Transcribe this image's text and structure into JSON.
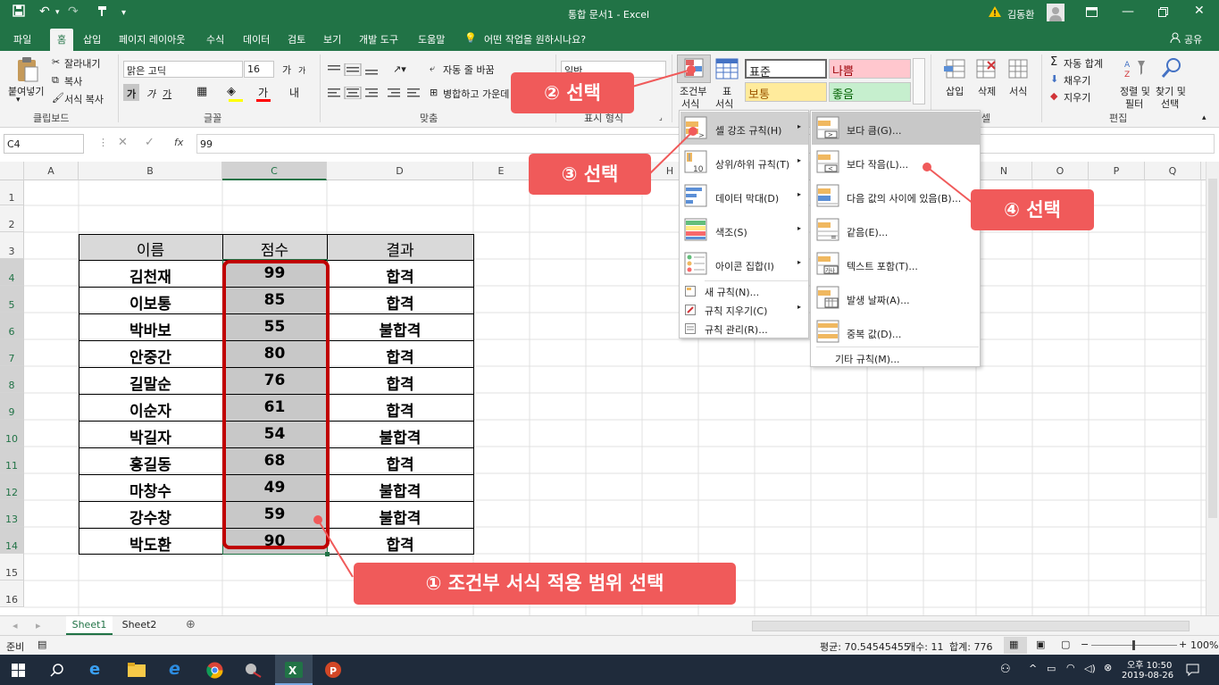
{
  "window": {
    "title": "통합 문서1  -  Excel",
    "user": "김동환",
    "share": "공유"
  },
  "tabs": [
    "파일",
    "홈",
    "삽입",
    "페이지 레이아웃",
    "수식",
    "데이터",
    "검토",
    "보기",
    "개발 도구",
    "도움말"
  ],
  "tell_me": "어떤 작업을 원하시나요?",
  "ribbon": {
    "clipboard": {
      "paste": "붙여넣기",
      "cut": "잘라내기",
      "copy": "복사",
      "format_painter": "서식 복사",
      "label": "클립보드"
    },
    "font": {
      "name": "맑은 고딕",
      "size": "16",
      "grow": "가",
      "shrink": "가",
      "bold": "가",
      "italic": "가",
      "underline": "가",
      "label": "글꼴"
    },
    "align": {
      "wrap": "자동 줄 바꿈",
      "merge": "병합하고 가운데",
      "label": "맞춤"
    },
    "number": {
      "format": "일반",
      "label": "표시 형식"
    },
    "styles": {
      "cond_format_1": "조건부",
      "cond_format_2": "서식",
      "table_1": "표",
      "table_2": "서식",
      "normal": "표준",
      "bad": "나쁨",
      "neutral": "보통",
      "good": "좋음"
    },
    "cells": {
      "insert": "삽입",
      "delete": "삭제",
      "format": "서식",
      "label": "셀"
    },
    "editing": {
      "autosum": "자동 합계",
      "fill": "채우기",
      "clear": "지우기",
      "sort_1": "정렬 및",
      "sort_2": "필터",
      "find_1": "찾기 및",
      "find_2": "선택",
      "label": "편집"
    }
  },
  "formula_bar": {
    "name_box": "C4",
    "fx": "fx",
    "value": "99"
  },
  "columns": [
    "A",
    "B",
    "C",
    "D",
    "E",
    "F",
    "G",
    "H",
    "I",
    "J",
    "K",
    "L",
    "M",
    "N",
    "O",
    "P",
    "Q"
  ],
  "rows": [
    "1",
    "2",
    "3",
    "4",
    "5",
    "6",
    "7",
    "8",
    "9",
    "10",
    "11",
    "12",
    "13",
    "14",
    "15",
    "16"
  ],
  "table": {
    "headers": [
      "이름",
      "점수",
      "결과"
    ],
    "rows": [
      [
        "김천재",
        "99",
        "합격"
      ],
      [
        "이보통",
        "85",
        "합격"
      ],
      [
        "박바보",
        "55",
        "불합격"
      ],
      [
        "안중간",
        "80",
        "합격"
      ],
      [
        "길말순",
        "76",
        "합격"
      ],
      [
        "이순자",
        "61",
        "합격"
      ],
      [
        "박길자",
        "54",
        "불합격"
      ],
      [
        "홍길동",
        "68",
        "합격"
      ],
      [
        "마창수",
        "49",
        "불합격"
      ],
      [
        "강수창",
        "59",
        "불합격"
      ],
      [
        "박도환",
        "90",
        "합격"
      ]
    ]
  },
  "cf_menu": [
    {
      "label": "셀 강조 규칙(H)",
      "arrow": "▸"
    },
    {
      "label": "상위/하위 규칙(T)",
      "arrow": "▸"
    },
    {
      "label": "데이터 막대(D)",
      "arrow": "▸"
    },
    {
      "label": "색조(S)",
      "arrow": "▸"
    },
    {
      "label": "아이콘 집합(I)",
      "arrow": "▸"
    }
  ],
  "cf_menu_small": [
    {
      "label": "새 규칙(N)..."
    },
    {
      "label": "규칙 지우기(C)",
      "arrow": "▸"
    },
    {
      "label": "규칙 관리(R)..."
    }
  ],
  "sub_menu": [
    {
      "label": "보다 큼(G)..."
    },
    {
      "label": "보다 작음(L)..."
    },
    {
      "label": "다음 값의 사이에 있음(B)..."
    },
    {
      "label": "같음(E)..."
    },
    {
      "label": "텍스트 포함(T)..."
    },
    {
      "label": "발생 날짜(A)..."
    },
    {
      "label": "중복 값(D)..."
    }
  ],
  "sub_menu_more": "기타 규칙(M)...",
  "callouts": {
    "c1": "① 조건부 서식 적용 범위 선택",
    "c2": "② 선택",
    "c3": "③ 선택",
    "c4": "④ 선택"
  },
  "sheets": [
    "Sheet1",
    "Sheet2"
  ],
  "status": {
    "ready": "준비",
    "average": "평균: 70.54545455",
    "count": "개수: 11",
    "sum": "합계: 776",
    "zoom": "100%"
  },
  "clock": {
    "time": "오후 10:50",
    "date": "2019-08-26"
  },
  "colors": {
    "excel_green": "#217346",
    "callout": "#f05a5a",
    "highlight": "#c00000",
    "selected_fill": "#c8c8c8",
    "header_fill": "#d9d9d9"
  }
}
